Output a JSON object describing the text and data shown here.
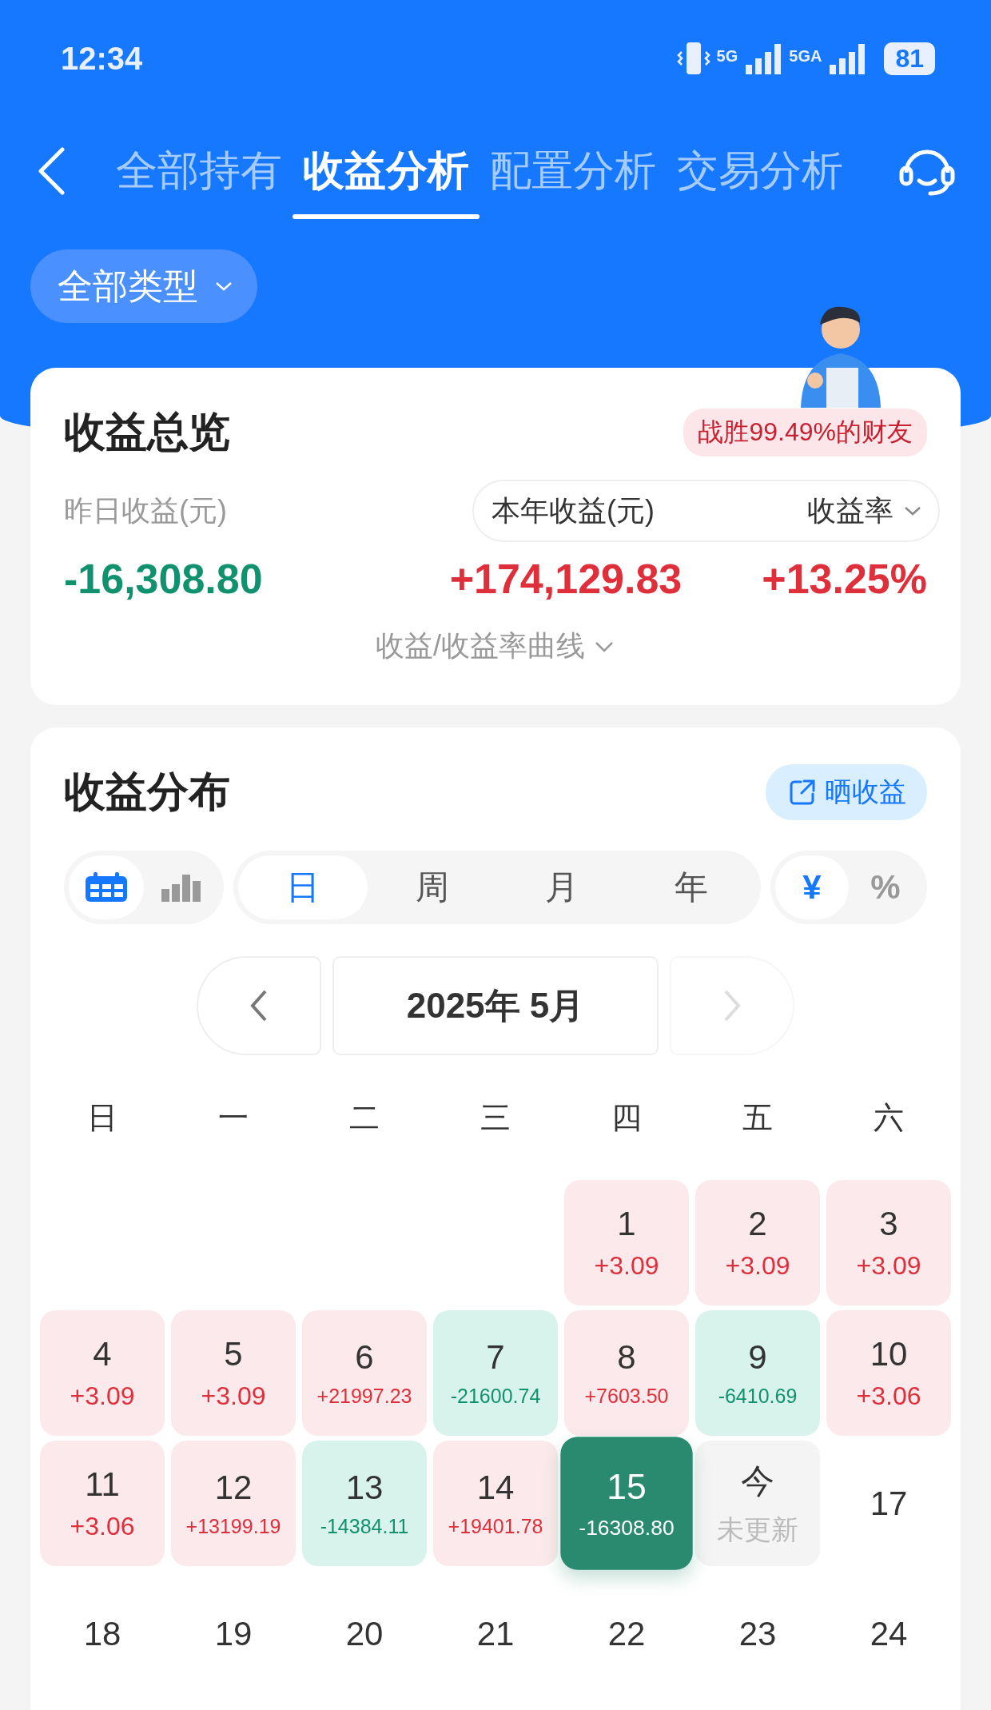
{
  "status_bar": {
    "time": "12:34",
    "network_1": "5G",
    "network_2": "5GA",
    "battery": "81"
  },
  "tabs": [
    {
      "label": "全部持有",
      "selected": false
    },
    {
      "label": "收益分析",
      "selected": true
    },
    {
      "label": "配置分析",
      "selected": false
    },
    {
      "label": "交易分析",
      "selected": false
    }
  ],
  "type_filter": {
    "label": "全部类型"
  },
  "overview": {
    "title": "收益总览",
    "badge": "战胜99.49%的财友",
    "yesterday_label": "昨日收益(元)",
    "yesterday_value": "-16,308.80",
    "year_label": "本年收益(元)",
    "rate_label": "收益率",
    "year_value": "+174,129.83",
    "rate_value": "+13.25%",
    "curve_toggle": "收益/收益率曲线"
  },
  "distribution": {
    "title": "收益分布",
    "share_button": "晒收益",
    "view_toggle": [
      {
        "kind": "calendar",
        "selected": true
      },
      {
        "kind": "bars",
        "selected": false
      }
    ],
    "periods": [
      {
        "label": "日",
        "selected": true
      },
      {
        "label": "周",
        "selected": false
      },
      {
        "label": "月",
        "selected": false
      },
      {
        "label": "年",
        "selected": false
      }
    ],
    "units": [
      {
        "label": "¥",
        "selected": true
      },
      {
        "label": "%",
        "selected": false
      }
    ],
    "month": "2025年 5月",
    "weekdays": [
      "日",
      "一",
      "二",
      "三",
      "四",
      "五",
      "六"
    ],
    "days": [
      {
        "kind": "blank"
      },
      {
        "kind": "blank"
      },
      {
        "kind": "blank"
      },
      {
        "kind": "blank"
      },
      {
        "day": "1",
        "value": "+3.09",
        "kind": "gain",
        "selected": false
      },
      {
        "day": "2",
        "value": "+3.09",
        "kind": "gain",
        "selected": false
      },
      {
        "day": "3",
        "value": "+3.09",
        "kind": "gain",
        "selected": false
      },
      {
        "day": "4",
        "value": "+3.09",
        "kind": "gain",
        "selected": false
      },
      {
        "day": "5",
        "value": "+3.09",
        "kind": "gain",
        "selected": false
      },
      {
        "day": "6",
        "value": "+21997.23",
        "kind": "gain",
        "selected": false
      },
      {
        "day": "7",
        "value": "-21600.74",
        "kind": "loss",
        "selected": false
      },
      {
        "day": "8",
        "value": "+7603.50",
        "kind": "gain",
        "selected": false
      },
      {
        "day": "9",
        "value": "-6410.69",
        "kind": "loss",
        "selected": false
      },
      {
        "day": "10",
        "value": "+3.06",
        "kind": "gain",
        "selected": false
      },
      {
        "day": "11",
        "value": "+3.06",
        "kind": "gain",
        "selected": false
      },
      {
        "day": "12",
        "value": "+13199.19",
        "kind": "gain",
        "selected": false
      },
      {
        "day": "13",
        "value": "-14384.11",
        "kind": "loss",
        "selected": false
      },
      {
        "day": "14",
        "value": "+19401.78",
        "kind": "gain",
        "selected": false
      },
      {
        "day": "15",
        "value": "-16308.80",
        "kind": "loss",
        "selected": true
      },
      {
        "day": "今",
        "value": "未更新",
        "kind": "today",
        "selected": false
      },
      {
        "day": "17",
        "kind": "plain",
        "selected": false
      },
      {
        "day": "18",
        "kind": "plain",
        "selected": false
      },
      {
        "day": "19",
        "kind": "plain",
        "selected": false
      },
      {
        "day": "20",
        "kind": "plain",
        "selected": false
      },
      {
        "day": "21",
        "kind": "plain",
        "selected": false
      },
      {
        "day": "22",
        "kind": "plain",
        "selected": false
      },
      {
        "day": "23",
        "kind": "plain",
        "selected": false
      },
      {
        "day": "24",
        "kind": "plain",
        "selected": false
      }
    ]
  }
}
